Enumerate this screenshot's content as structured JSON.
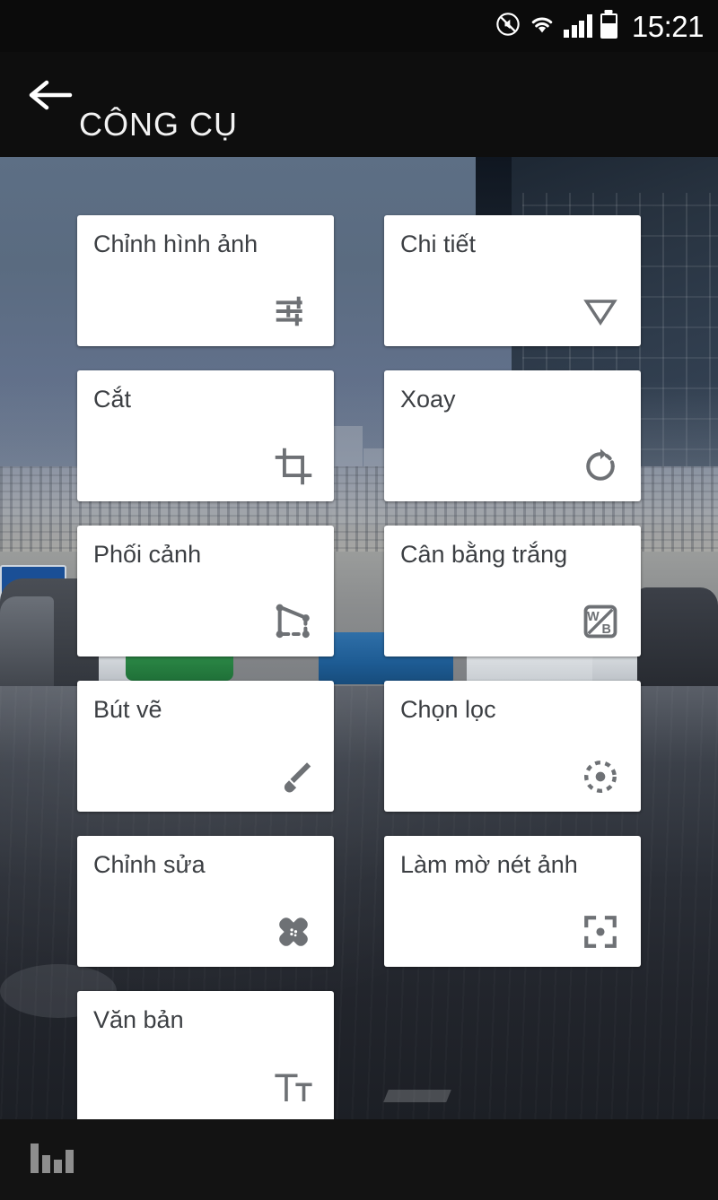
{
  "statusbar": {
    "time": "15:21",
    "icons": [
      "mute-icon",
      "wifi-icon",
      "signal-icon",
      "battery-icon"
    ]
  },
  "appbar": {
    "back_icon": "back-arrow-icon",
    "title": "CÔNG CỤ"
  },
  "tools": [
    {
      "label": "Chỉnh hình ảnh",
      "icon": "tune-sliders-icon"
    },
    {
      "label": "Chi tiết",
      "icon": "triangle-down-icon"
    },
    {
      "label": "Cắt",
      "icon": "crop-icon"
    },
    {
      "label": "Xoay",
      "icon": "rotate-icon"
    },
    {
      "label": "Phối cảnh",
      "icon": "perspective-icon"
    },
    {
      "label": "Cân bằng trắng",
      "icon": "white-balance-icon"
    },
    {
      "label": "Bút vẽ",
      "icon": "brush-icon"
    },
    {
      "label": "Chọn lọc",
      "icon": "selective-icon"
    },
    {
      "label": "Chỉnh sửa",
      "icon": "healing-icon"
    },
    {
      "label": "Làm mờ nét ảnh",
      "icon": "lens-blur-icon"
    },
    {
      "label": "Văn bản",
      "icon": "text-tt-icon"
    }
  ],
  "bottombar": {
    "histogram_icon": "histogram-icon"
  },
  "colors": {
    "card_bg": "#ffffff",
    "label_text": "#3c3f43",
    "icon_gray": "#6e7175",
    "bar_bg": "#0e0e0e",
    "status_text": "#ffffff"
  }
}
